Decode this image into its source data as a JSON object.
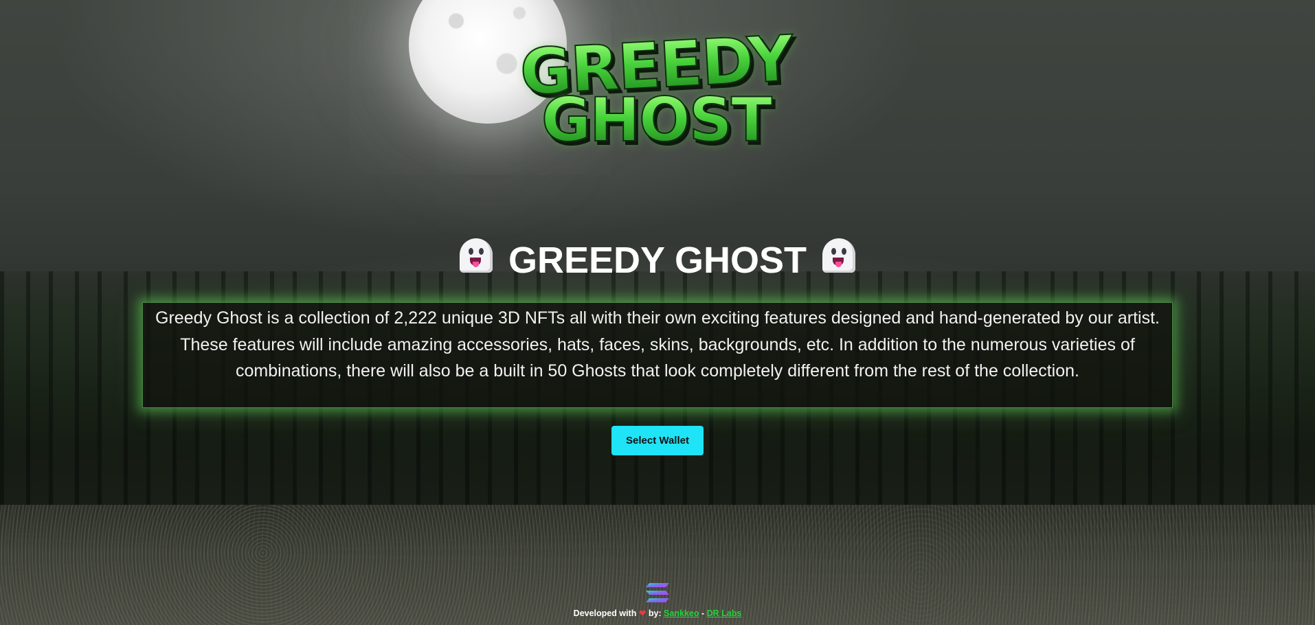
{
  "logo": {
    "line1": "GREEDY",
    "line2": "GHOST"
  },
  "hero": {
    "title": "GREEDY GHOST",
    "title_icon": "ghost-emoji"
  },
  "description": "Greedy Ghost is a collection of 2,222 unique 3D NFTs all with their own exciting features designed and hand-generated by our artist. These features will include amazing accessories, hats, faces, skins, backgrounds, etc. In addition to the numerous varieties of combinations, there will also be a built in 50 Ghosts that look completely different from the rest of the collection.",
  "wallet": {
    "button_label": "Select Wallet"
  },
  "footer": {
    "icon": "solana-logo-icon",
    "prefix": "Developed with",
    "heart": "❤",
    "by": "by:",
    "link1": "Sankkeo",
    "separator": "-",
    "link2": "DR Labs"
  },
  "colors": {
    "button_bg": "#1fe4f7",
    "link_green": "#22d33a",
    "glow_green": "#64d25a",
    "logo_green": "#49d23c"
  }
}
